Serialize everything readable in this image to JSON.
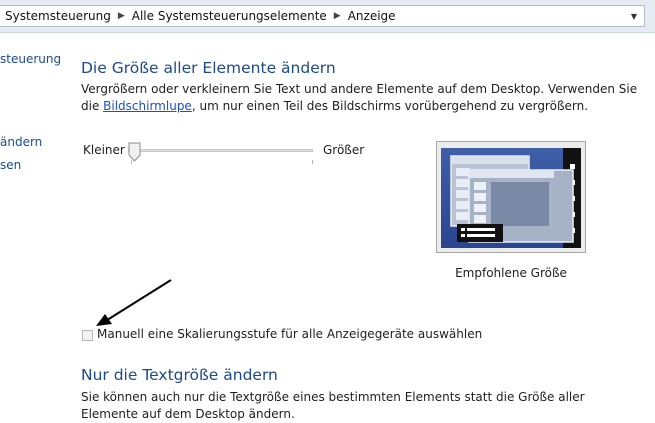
{
  "breadcrumb": {
    "items": [
      "Systemsteuerung",
      "Alle Systemsteuerungselemente",
      "Anzeige"
    ],
    "separator": "▶",
    "dropdown_icon": "chevron-down-icon"
  },
  "sidebar": {
    "links": [
      "steuerung",
      "ändern",
      "sen"
    ]
  },
  "section1": {
    "title": "Die Größe aller Elemente ändern",
    "description_pre": "Vergrößern oder verkleinern Sie Text und andere Elemente auf dem Desktop. Verwenden Sie die ",
    "link": "Bildschirmlupe",
    "description_post": ", um nur einen Teil des Bildschirms vorübergehend zu vergrößern."
  },
  "slider": {
    "min_label": "Kleiner",
    "max_label": "Größer",
    "value_fraction": 0.0
  },
  "preview": {
    "caption": "Empfohlene Größe"
  },
  "checkbox": {
    "label": "Manuell eine Skalierungsstufe für alle Anzeigegeräte auswählen",
    "checked": false
  },
  "section2": {
    "title": "Nur die Textgröße ändern",
    "description": "Sie können auch nur die Textgröße eines bestimmten Elements statt die Größe aller Elemente auf dem Desktop ändern."
  },
  "colors": {
    "link": "#1a50c8",
    "heading": "#1e4a8a",
    "address_bar": "#e6ecf2"
  }
}
